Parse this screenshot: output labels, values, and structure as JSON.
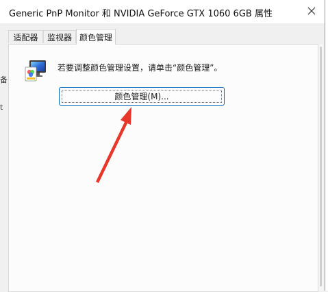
{
  "window": {
    "title": "Generic PnP Monitor 和 NVIDIA GeForce GTX 1060 6GB 属性"
  },
  "tabs": [
    {
      "label": "适配器"
    },
    {
      "label": "监视器"
    },
    {
      "label": "颜色管理",
      "active": true
    }
  ],
  "color_management": {
    "instruction_text": "若要调整颜色管理设置，请单击“颜色管理”。",
    "button_label": "颜色管理(M)..."
  },
  "background_fragments": [
    "备",
    "t"
  ],
  "colors": {
    "accent": "#0067c0",
    "annotation_arrow": "#e8362b"
  }
}
